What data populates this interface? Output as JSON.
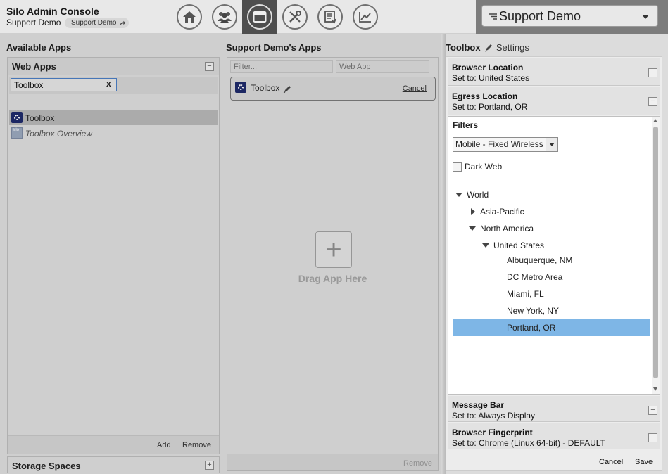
{
  "header": {
    "title": "Silo Admin Console",
    "subtitle": "Support Demo",
    "chip_label": "Support Demo",
    "nav": [
      "home-icon",
      "users-icon",
      "window-icon",
      "tools-icon",
      "report-icon",
      "chart-icon"
    ],
    "org_select": "Support Demo"
  },
  "left": {
    "title": "Available Apps",
    "panel_title": "Web Apps",
    "search_value": "Toolbox",
    "search_clear": "x",
    "items": [
      {
        "label": "Toolbox",
        "icon": "gear-icon",
        "selected": true
      },
      {
        "label": "Toolbox Overview",
        "icon": "silo-icon",
        "selected": false
      }
    ],
    "add_label": "Add",
    "remove_label": "Remove",
    "storage_title": "Storage Spaces"
  },
  "middle": {
    "title": "Support Demo's Apps",
    "filter_placeholder": "Filter...",
    "type_placeholder": "Web App",
    "card_label": "Toolbox",
    "card_cancel": "Cancel",
    "drop_label": "Drag App Here",
    "remove_label": "Remove"
  },
  "right": {
    "title": "Toolbox",
    "settings_label": "Settings",
    "sections": {
      "browser_location": {
        "name": "Browser Location",
        "value": "Set to: United States"
      },
      "egress_location": {
        "name": "Egress Location",
        "value": "Set to: Portland, OR"
      },
      "message_bar": {
        "name": "Message Bar",
        "value": "Set to: Always Display"
      },
      "browser_fingerprint": {
        "name": "Browser Fingerprint",
        "value": "Set to: Chrome (Linux 64-bit) - DEFAULT"
      }
    },
    "filters_label": "Filters",
    "network_select": "Mobile - Fixed Wireless",
    "dark_web_label": "Dark Web",
    "tree": {
      "world": "World",
      "asia_pacific": "Asia-Pacific",
      "north_america": "North America",
      "united_states": "United States",
      "cities": [
        "Albuquerque, NM",
        "DC Metro Area",
        "Miami, FL",
        "New York, NY",
        "Portland, OR"
      ],
      "selected": "Portland, OR"
    },
    "cancel_label": "Cancel",
    "save_label": "Save"
  }
}
